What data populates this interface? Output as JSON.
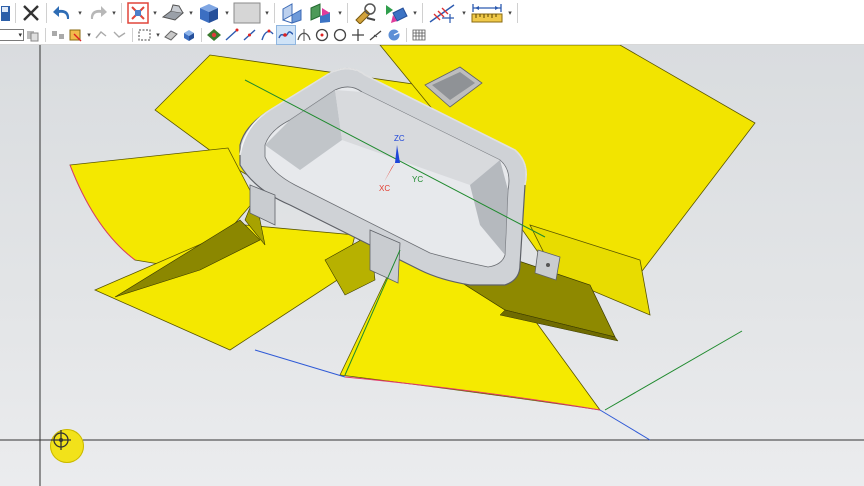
{
  "window": {
    "toolbar_top": [
      {
        "name": "save-icon"
      },
      {
        "name": "close-icon"
      },
      {
        "name": "undo-icon"
      },
      {
        "name": "redo-icon"
      },
      {
        "name": "fit-view-icon"
      },
      {
        "name": "shade-mode-icon"
      },
      {
        "name": "solid-cube-icon"
      },
      {
        "name": "background-view-icon"
      },
      {
        "name": "orient-view-icon"
      },
      {
        "name": "view-direction-icon"
      },
      {
        "name": "snap-tools-icon"
      },
      {
        "name": "move-object-icon"
      },
      {
        "name": "analysis-icon"
      },
      {
        "name": "measure-icon"
      }
    ],
    "toolbar_selection": [
      {
        "name": "filter-icon"
      },
      {
        "name": "select-all-icon"
      },
      {
        "name": "general-select-icon"
      },
      {
        "name": "box-select-icon"
      },
      {
        "name": "face-select-icon"
      },
      {
        "name": "body-select-icon"
      },
      {
        "name": "snap-endpoint-icon"
      },
      {
        "name": "snap-line-icon"
      },
      {
        "name": "snap-midpoint-icon"
      },
      {
        "name": "snap-curve-icon"
      },
      {
        "name": "snap-intersection-icon"
      },
      {
        "name": "snap-center-icon"
      },
      {
        "name": "snap-circle-icon"
      },
      {
        "name": "snap-point-icon"
      },
      {
        "name": "snap-quadrant-icon"
      },
      {
        "name": "snap-arc-icon"
      },
      {
        "name": "grid-icon"
      }
    ]
  },
  "viewport": {
    "csys": {
      "zc_label": "ZC",
      "xc_label": "XC",
      "yc_label": "YC",
      "zc_color": "#1f46d9",
      "xc_color": "#e23b2e",
      "yc_color": "#1f8a2e"
    },
    "surface_color": "#f4e800",
    "surface_edge_color": "#3a3a00",
    "body_color": "#cfd2d6",
    "wcs_badge_icon": "wcs-crosshair-icon"
  }
}
